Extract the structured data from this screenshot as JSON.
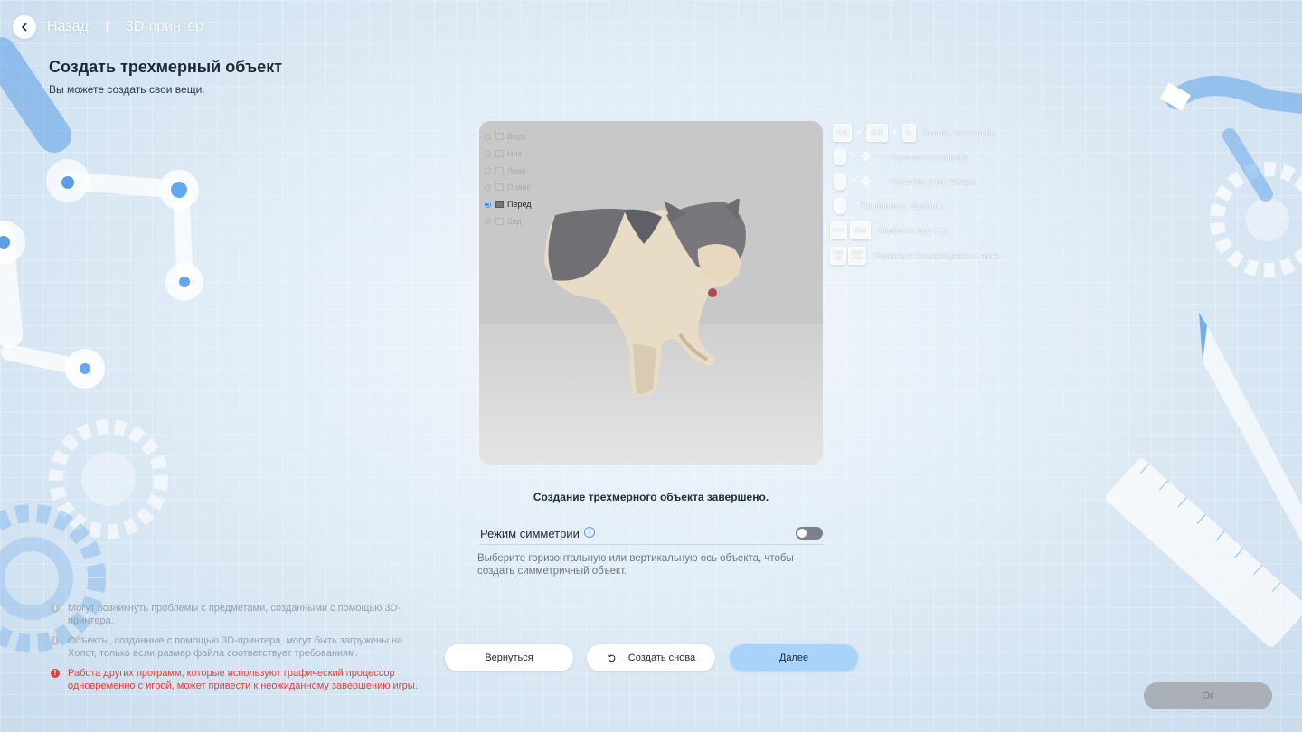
{
  "header": {
    "back_label": "Назад",
    "breadcrumb": "3D-принтер"
  },
  "page": {
    "title": "Создать трехмерный объект",
    "subtitle": "Вы можете создать свои вещи."
  },
  "preview": {
    "views": [
      {
        "label": "Верх",
        "selected": false
      },
      {
        "label": "Низ",
        "selected": false
      },
      {
        "label": "Лево",
        "selected": false
      },
      {
        "label": "Право",
        "selected": false
      },
      {
        "label": "Перед",
        "selected": true
      },
      {
        "label": "Зад",
        "selected": false
      }
    ]
  },
  "shortcuts": {
    "hide_ui": {
      "keys": [
        "Ctrl",
        "Shift",
        "U"
      ],
      "text": "Скрыть интерфейс"
    },
    "move_camera": {
      "text": "Переместить камеру"
    },
    "rotate_camera": {
      "text": "Изменить угол камеры"
    },
    "zoom": {
      "text": "Приблизить, отдалить"
    },
    "wall_view": {
      "keys": [
        "Home",
        "End"
      ],
      "text": "Изменить вид стен"
    },
    "up_down": {
      "keys": [
        "Page Up",
        "Page Down"
      ],
      "text": "Подняться выше/подняться ниже"
    }
  },
  "status": {
    "done": "Создание трехмерного объекта завершено."
  },
  "symmetry": {
    "label": "Режим симметрии",
    "enabled": false,
    "description": "Выберите горизонтальную или вертикальную ось объекта, чтобы создать симметричный объект."
  },
  "buttons": {
    "back": "Вернуться",
    "again": "Создать снова",
    "next": "Далее",
    "ok": "Ок"
  },
  "notes": [
    {
      "text": "Могут возникнуть проблемы с предметами, созданными с помощью 3D-принтера.",
      "type": "info"
    },
    {
      "text": "Объекты, созданные с помощью 3D-принтера, могут быть загружены на Холст, только если размер файла соответствует требованиям.",
      "type": "info"
    },
    {
      "text": "Работа других программ, которые используют графический процессор одновременно с игрой, может привести к неожиданному завершению игры.",
      "type": "warning"
    }
  ],
  "colors": {
    "accent": "#a8d3fb",
    "warning": "#e0413d",
    "toggle_off": "#7c8088"
  }
}
